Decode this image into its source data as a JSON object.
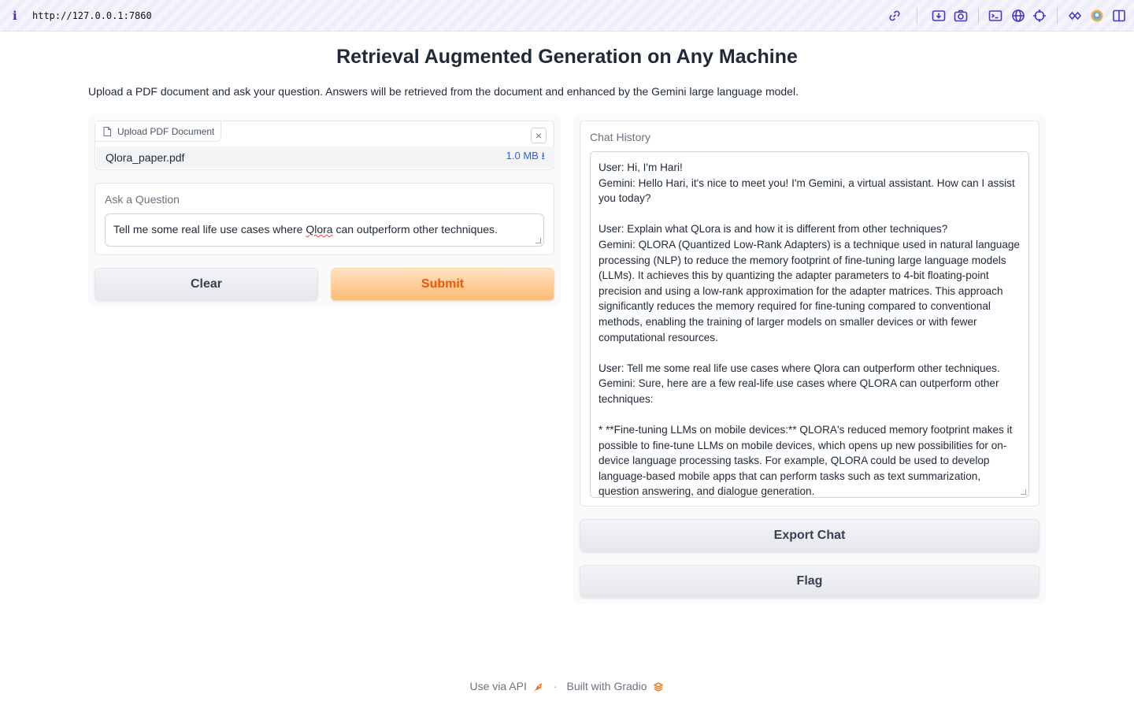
{
  "browser": {
    "url": "http://127.0.0.1:7860",
    "icons": [
      "link-icon",
      "download-icon",
      "camera-icon",
      "terminal-icon",
      "globe-icon",
      "crosshair-icon",
      "extensions-icon",
      "profile-icon",
      "sidebar-icon"
    ]
  },
  "page": {
    "title": "Retrieval Augmented Generation on Any Machine",
    "description": "Upload a PDF document and ask your question. Answers will be retrieved from the document and enhanced by the Gemini large language model."
  },
  "upload": {
    "label": "Upload PDF Document",
    "close": "×",
    "file_name": "Qlora_paper.pdf",
    "file_size": "1.0 MB ⭳"
  },
  "question": {
    "label": "Ask a Question",
    "value_before": "Tell me some real life use cases where ",
    "value_marked": "Qlora",
    "value_after": " can outperform other techniques."
  },
  "buttons": {
    "clear": "Clear",
    "submit": "Submit",
    "export": "Export Chat",
    "flag": "Flag"
  },
  "chat": {
    "label": "Chat History",
    "lines": [
      "User: Hi, I'm Hari!",
      "Gemini: Hello Hari, it's nice to meet you! I'm Gemini, a virtual assistant. How can I assist you today?",
      "",
      "User: Explain what QLora is and how it is different from other techniques?",
      "Gemini: QLORA (Quantized Low-Rank Adapters) is a technique used in natural language processing (NLP) to reduce the memory footprint of fine-tuning large language models (LLMs). It achieves this by quantizing the adapter parameters to 4-bit floating-point precision and using a low-rank approximation for the adapter matrices. This approach significantly reduces the memory required for fine-tuning compared to conventional methods, enabling the training of larger models on smaller devices or with fewer computational resources.",
      "",
      "User: Tell me some real life use cases where Qlora can outperform other techniques.",
      "Gemini: Sure, here are a few real-life use cases where QLORA can outperform other techniques:",
      "",
      "* **Fine-tuning LLMs on mobile devices:** QLORA's reduced memory footprint makes it possible to fine-tune LLMs on mobile devices, which opens up new possibilities for on-device language processing tasks. For example, QLORA could be used to develop language-based mobile apps that can perform tasks such as text summarization, question answering, and dialogue generation."
    ]
  },
  "footer": {
    "api": "Use via API",
    "separator": "·",
    "built": "Built with Gradio"
  }
}
